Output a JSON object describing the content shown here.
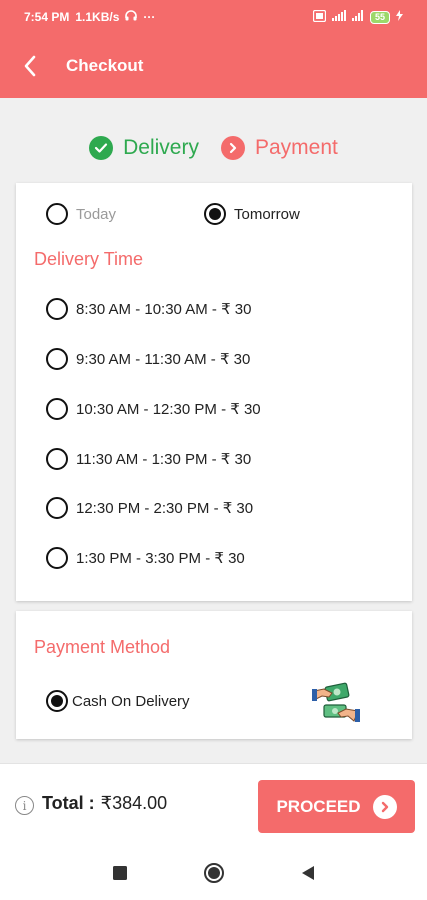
{
  "status_bar": {
    "time": "7:54 PM",
    "speed": "1.1KB/s",
    "dots": "···",
    "battery": "55"
  },
  "app_bar": {
    "title": "Checkout"
  },
  "steps": {
    "delivery": "Delivery",
    "payment": "Payment"
  },
  "delivery_day": {
    "options": [
      "Today",
      "Tomorrow"
    ],
    "selected": "Tomorrow"
  },
  "delivery_time": {
    "title": "Delivery Time",
    "slots": [
      "8:30 AM - 10:30 AM - ₹ 30",
      "9:30 AM - 11:30 AM - ₹ 30",
      "10:30 AM - 12:30 PM - ₹ 30",
      "11:30 AM -  1:30 PM - ₹ 30",
      "12:30 PM - 2:30 PM - ₹ 30",
      "1:30 PM - 3:30 PM - ₹ 30"
    ]
  },
  "payment_method": {
    "title": "Payment Method",
    "option": "Cash On Delivery",
    "icon": "cash-hands-icon"
  },
  "footer": {
    "total_label": "Total :",
    "total_value": "₹384.00",
    "proceed_label": "PROCEED"
  },
  "colors": {
    "accent": "#f46b6b",
    "success": "#2ea94f"
  }
}
